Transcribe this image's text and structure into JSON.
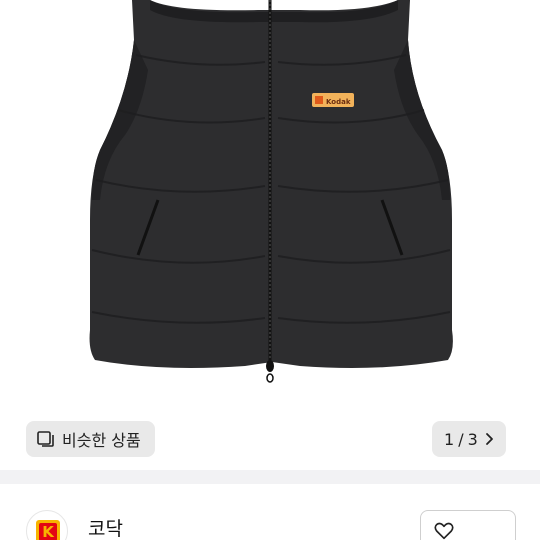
{
  "product": {
    "image_alt": "black puffer vest",
    "brand_patch": "Kodak"
  },
  "similar": {
    "label": "비슷한 상품",
    "icon": "similar-items-icon"
  },
  "pager": {
    "current": "1",
    "separator": "/",
    "total": "3",
    "icon": "chevron-right-icon"
  },
  "seller": {
    "name": "코닥",
    "logo_icon": "kodak-logo",
    "logo_letter": "K",
    "action_icon": "heart-icon"
  },
  "colors": {
    "vest": "#2b2b2d",
    "chip_bg": "#e9e9e9",
    "band": "#f2f2f4",
    "kodak_yellow": "#f7b400",
    "kodak_red": "#e30613"
  }
}
